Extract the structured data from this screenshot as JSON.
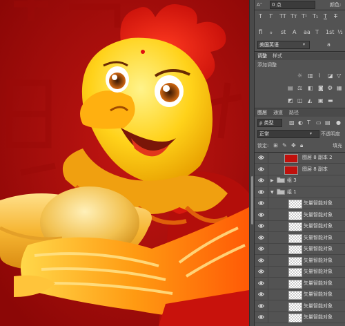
{
  "canvas": {
    "background": "#a80d0a"
  },
  "panel": {
    "top": {
      "field_value": "0 点",
      "color_label": "颜色:"
    },
    "language": {
      "value": "美国英语"
    },
    "adjustments": {
      "tabs": [
        "调整",
        "样式"
      ],
      "add_label": "添加调整"
    },
    "layers": {
      "tabs": [
        "图层",
        "通道",
        "路径"
      ],
      "kind_filter": "ρ 类型",
      "blend_mode": "正常",
      "opacity_label": "不透明度",
      "lock_label": "锁定:",
      "fill_label": "填充",
      "items": [
        {
          "name": "图层 8 副本 2",
          "kind": "red-thumb"
        },
        {
          "name": "图层 8 副本",
          "kind": "red-thumb"
        },
        {
          "name": "组 3",
          "kind": "group-collapsed"
        },
        {
          "name": "组 1",
          "kind": "group-expanded"
        },
        {
          "name": "矢量智能对象",
          "kind": "smart-object"
        },
        {
          "name": "矢量智能对象",
          "kind": "smart-object"
        },
        {
          "name": "矢量智能对象",
          "kind": "smart-object"
        },
        {
          "name": "矢量智能对象",
          "kind": "smart-object"
        },
        {
          "name": "矢量智能对象",
          "kind": "smart-object"
        },
        {
          "name": "矢量智能对象",
          "kind": "smart-object"
        },
        {
          "name": "矢量智能对象",
          "kind": "smart-object"
        },
        {
          "name": "矢量智能对象",
          "kind": "smart-object"
        },
        {
          "name": "矢量智能对象",
          "kind": "smart-object"
        },
        {
          "name": "矢量智能对象",
          "kind": "smart-object"
        },
        {
          "name": "矢量智能对象",
          "kind": "smart-object"
        }
      ]
    }
  }
}
